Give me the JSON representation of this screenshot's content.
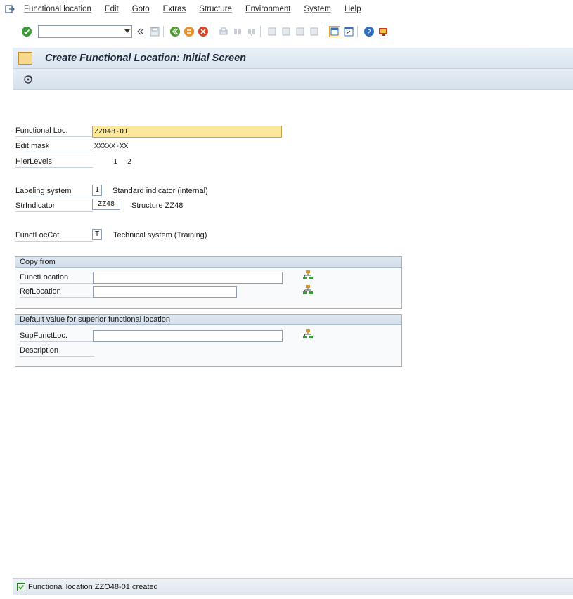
{
  "menubar": {
    "items": [
      "Functional location",
      "Edit",
      "Goto",
      "Extras",
      "Structure",
      "Environment",
      "System",
      "Help"
    ]
  },
  "screen": {
    "title": "Create Functional Location: Initial Screen"
  },
  "form": {
    "functional_loc": {
      "label": "Functional Loc.",
      "value": "ZZ048-01"
    },
    "edit_mask": {
      "label": "Edit mask",
      "value": "XXXXX-XX"
    },
    "hier_levels": {
      "label": "HierLevels",
      "level1": "1",
      "level2": "2"
    },
    "labeling_system": {
      "label": "Labeling system",
      "value": "1",
      "text": "Standard indicator (internal)"
    },
    "str_indicator": {
      "label": "StrIndicator",
      "value": "ZZ48",
      "text": "Structure ZZ48"
    },
    "funct_loc_cat": {
      "label": "FunctLocCat.",
      "value": "T",
      "text": "Technical system (Training)"
    }
  },
  "copy_from": {
    "heading": "Copy from",
    "funct_location": {
      "label": "FunctLocation",
      "value": ""
    },
    "ref_location": {
      "label": "RefLocation",
      "value": ""
    }
  },
  "superior": {
    "heading": "Default value for superior functional location",
    "sup_funct_loc": {
      "label": "SupFunctLoc.",
      "value": ""
    },
    "description": {
      "label": "Description"
    }
  },
  "status": {
    "message": "Functional location ZZO48-01 created"
  },
  "colors": {
    "focus_field": "#fbe89a",
    "header_bg": "#dbe5ef",
    "ok_green": "#2f9a2f"
  }
}
